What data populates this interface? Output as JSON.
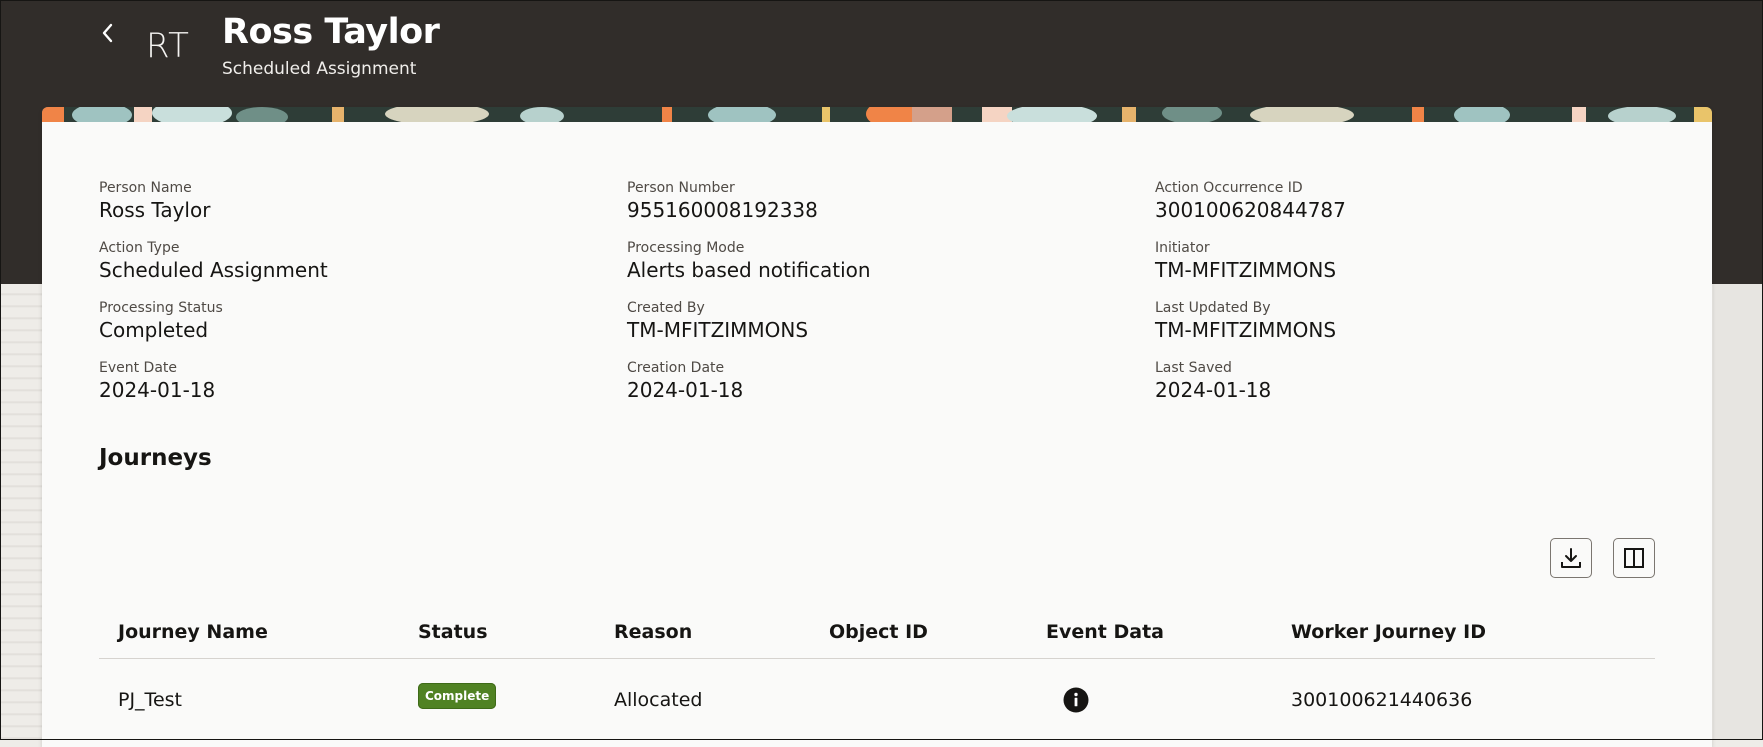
{
  "header": {
    "back_icon": "chevron-left-icon",
    "avatar_initials": "RT",
    "title": "Ross Taylor",
    "subtitle": "Scheduled Assignment"
  },
  "details": {
    "person_name": {
      "label": "Person Name",
      "value": "Ross Taylor"
    },
    "person_number": {
      "label": "Person Number",
      "value": "955160008192338"
    },
    "action_occurrence_id": {
      "label": "Action Occurrence ID",
      "value": "300100620844787"
    },
    "action_type": {
      "label": "Action Type",
      "value": "Scheduled Assignment"
    },
    "processing_mode": {
      "label": "Processing Mode",
      "value": "Alerts based notification"
    },
    "initiator": {
      "label": "Initiator",
      "value": "TM-MFITZIMMONS"
    },
    "processing_status": {
      "label": "Processing Status",
      "value": "Completed"
    },
    "created_by": {
      "label": "Created By",
      "value": "TM-MFITZIMMONS"
    },
    "last_updated_by": {
      "label": "Last Updated By",
      "value": "TM-MFITZIMMONS"
    },
    "event_date": {
      "label": "Event Date",
      "value": "2024-01-18"
    },
    "creation_date": {
      "label": "Creation Date",
      "value": "2024-01-18"
    },
    "last_saved": {
      "label": "Last Saved",
      "value": "2024-01-18"
    }
  },
  "journeys": {
    "title": "Journeys",
    "toolbar": {
      "download_icon": "download-icon",
      "columns_icon": "columns-icon"
    },
    "columns": [
      "Journey Name",
      "Status",
      "Reason",
      "Object ID",
      "Event Data",
      "Worker Journey ID"
    ],
    "rows": [
      {
        "journey_name": "PJ_Test",
        "status": "Complete",
        "reason": "Allocated",
        "object_id": "",
        "event_data_icon": "info-icon",
        "worker_journey_id": "300100621440636"
      }
    ]
  },
  "colors": {
    "header_bg": "#312d2a",
    "card_bg": "#fafaf9",
    "status_complete": "#508223"
  }
}
